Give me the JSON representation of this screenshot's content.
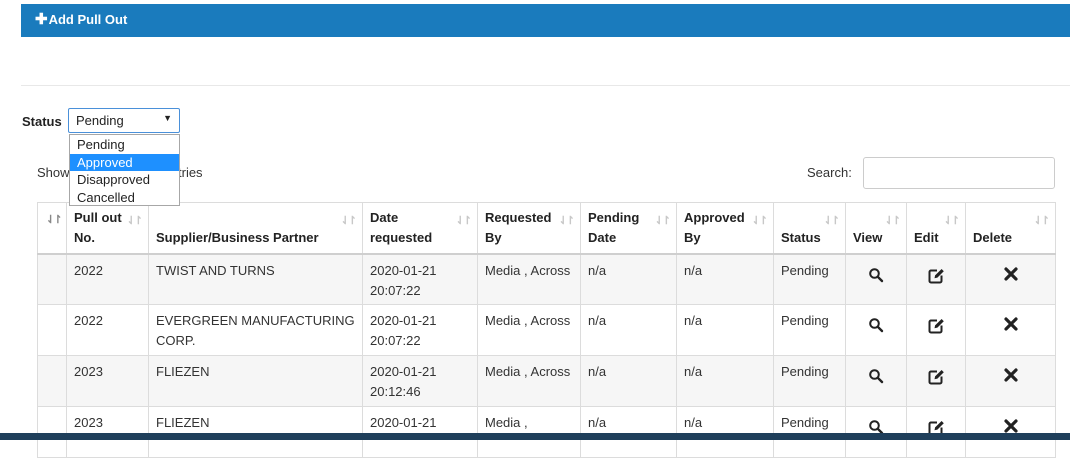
{
  "toolbar": {
    "add_label": "Add Pull Out",
    "add_icon": "plus-icon"
  },
  "filter": {
    "label": "Status",
    "selected": "Pending",
    "options": [
      {
        "label": "Pending"
      },
      {
        "label": "Approved"
      },
      {
        "label": "Disapproved"
      },
      {
        "label": "Cancelled"
      }
    ],
    "highlighted": "Approved"
  },
  "length": {
    "show_text": "Show",
    "entries_text": "tries"
  },
  "search": {
    "label": "Search:",
    "value": ""
  },
  "table": {
    "columns": [
      {
        "label": ""
      },
      {
        "label": "Pull out No."
      },
      {
        "label": "Supplier/Business Partner"
      },
      {
        "label": "Date requested"
      },
      {
        "label": "Requested By"
      },
      {
        "label": "Pending Date"
      },
      {
        "label": "Approved By"
      },
      {
        "label": "Status"
      },
      {
        "label": "View"
      },
      {
        "label": "Edit"
      },
      {
        "label": "Delete"
      }
    ],
    "rows": [
      {
        "pull_out_no": "2022",
        "supplier": "TWIST AND TURNS",
        "date_requested": "2020-01-21 20:07:22",
        "requested_by": "Media , Across",
        "pending_date": "n/a",
        "approved_by": "n/a",
        "status": "Pending"
      },
      {
        "pull_out_no": "2022",
        "supplier": "EVERGREEN MANUFACTURING CORP.",
        "date_requested": "2020-01-21 20:07:22",
        "requested_by": "Media , Across",
        "pending_date": "n/a",
        "approved_by": "n/a",
        "status": "Pending"
      },
      {
        "pull_out_no": "2023",
        "supplier": "FLIEZEN",
        "date_requested": "2020-01-21 20:12:46",
        "requested_by": "Media , Across",
        "pending_date": "n/a",
        "approved_by": "n/a",
        "status": "Pending"
      },
      {
        "pull_out_no": "2023",
        "supplier": "FLIEZEN",
        "date_requested": "2020-01-21",
        "requested_by": "Media ,",
        "pending_date": "n/a",
        "approved_by": "n/a",
        "status": "Pending"
      }
    ]
  },
  "colors": {
    "header_bar": "#1a7bbd",
    "dropdown_highlight": "#1e90ff",
    "bottom_strip": "#1f3f5b"
  }
}
